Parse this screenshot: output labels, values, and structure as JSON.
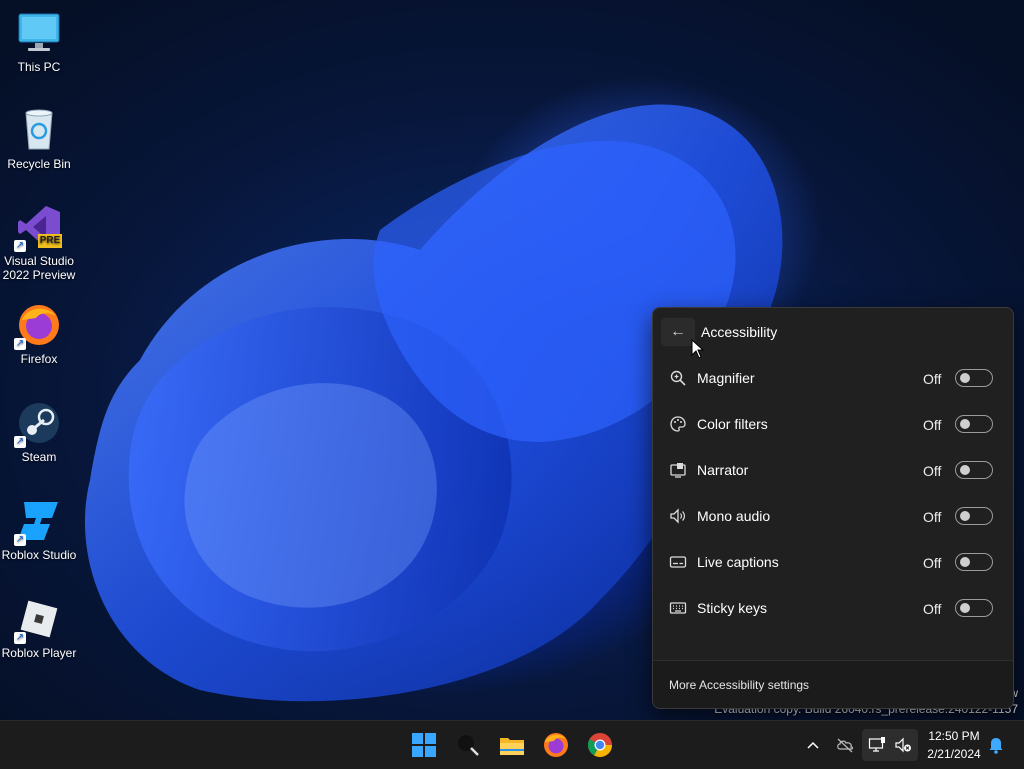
{
  "desktop": {
    "icons": [
      {
        "label": "This PC"
      },
      {
        "label": "Recycle Bin"
      },
      {
        "label": "Visual Studio 2022 Preview",
        "badge": "PRE"
      },
      {
        "label": "Firefox"
      },
      {
        "label": "Steam"
      },
      {
        "label": "Roblox Studio"
      },
      {
        "label": "Roblox Player"
      }
    ]
  },
  "flyout": {
    "title": "Accessibility",
    "back_icon": "back-arrow-icon",
    "items": [
      {
        "label": "Magnifier",
        "state": "Off",
        "icon": "magnifier-icon"
      },
      {
        "label": "Color filters",
        "state": "Off",
        "icon": "palette-icon"
      },
      {
        "label": "Narrator",
        "state": "Off",
        "icon": "narrator-icon"
      },
      {
        "label": "Mono audio",
        "state": "Off",
        "icon": "speaker-icon"
      },
      {
        "label": "Live captions",
        "state": "Off",
        "icon": "captions-icon"
      },
      {
        "label": "Sticky keys",
        "state": "Off",
        "icon": "keyboard-icon"
      }
    ],
    "footer_link": "More Accessibility settings"
  },
  "watermark": {
    "line1": "w",
    "line2": "Evaluation copy. Build 26040.rs_prerelease.240122-1157"
  },
  "taskbar": {
    "apps": [
      "start-icon",
      "search-icon",
      "file-explorer-icon",
      "firefox-icon",
      "chrome-icon"
    ],
    "clock": {
      "time": "12:50 PM",
      "date": "2/21/2024"
    }
  },
  "colors": {
    "flyout_bg": "#202020",
    "taskbar_bg": "#1c1c1c",
    "accent": "#0078d4"
  }
}
